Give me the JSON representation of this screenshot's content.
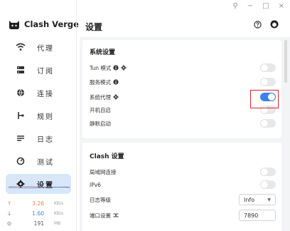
{
  "window_controls": {
    "pin": "⚲",
    "minimize": "−",
    "maximize": "□",
    "close": "×"
  },
  "brand": {
    "name": "Clash Verge"
  },
  "nav": [
    {
      "label": "代理",
      "icon": "wifi-icon"
    },
    {
      "label": "订阅",
      "icon": "profiles-icon"
    },
    {
      "label": "连接",
      "icon": "globe-icon"
    },
    {
      "label": "规则",
      "icon": "rules-icon"
    },
    {
      "label": "日志",
      "icon": "logs-icon"
    },
    {
      "label": "测试",
      "icon": "test-icon"
    },
    {
      "label": "设置",
      "icon": "gear-icon",
      "active": true
    }
  ],
  "traffic": {
    "upload": {
      "arrow": "↑",
      "value": "3.26",
      "unit": "KB/s"
    },
    "download": {
      "arrow": "↓",
      "value": "1.60",
      "unit": "KB/s"
    },
    "connections": {
      "arrow": "⊙",
      "value": "191",
      "unit": "MB"
    }
  },
  "header": {
    "title": "设置"
  },
  "system_section": {
    "title": "系统设置",
    "rows": [
      {
        "label": "Tun 模式",
        "enabled": false
      },
      {
        "label": "服务模式",
        "enabled": false
      },
      {
        "label": "系统代理",
        "enabled": true
      },
      {
        "label": "开机自启",
        "enabled": false
      },
      {
        "label": "静默启动",
        "enabled": false
      }
    ]
  },
  "clash_section": {
    "title": "Clash 设置",
    "rows": [
      {
        "label": "局域网连接",
        "enabled": false
      },
      {
        "label": "IPv6",
        "enabled": false
      }
    ],
    "log_level": {
      "label": "日志等级",
      "value": "Info"
    },
    "port": {
      "label": "端口设置",
      "value": "7890"
    }
  },
  "colors": {
    "accent": "#3b82e6",
    "active_nav_bg": "#d6e7fb",
    "highlight": "#d8232a"
  }
}
